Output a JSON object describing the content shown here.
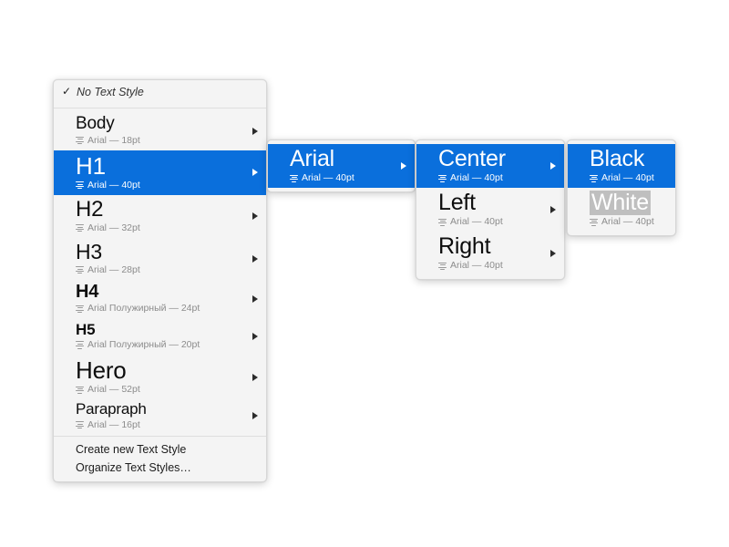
{
  "menus": {
    "text_styles": {
      "header": {
        "checkmark": "✓",
        "label": "No Text Style"
      },
      "items": [
        {
          "title": "Body",
          "sub": "Arial — 18pt",
          "selected": false,
          "size_class": "t-body"
        },
        {
          "title": "H1",
          "sub": "Arial — 40pt",
          "selected": true,
          "size_class": "t-h1"
        },
        {
          "title": "H2",
          "sub": "Arial — 32pt",
          "selected": false,
          "size_class": "t-h2"
        },
        {
          "title": "H3",
          "sub": "Arial — 28pt",
          "selected": false,
          "size_class": "t-h3"
        },
        {
          "title": "H4",
          "sub": "Arial Полужирный — 24pt",
          "selected": false,
          "size_class": "t-h4"
        },
        {
          "title": "H5",
          "sub": "Arial Полужирный — 20pt",
          "selected": false,
          "size_class": "t-h5"
        },
        {
          "title": "Hero",
          "sub": "Arial — 52pt",
          "selected": false,
          "size_class": "t-hero"
        },
        {
          "title": "Parapraph",
          "sub": "Arial — 16pt",
          "selected": false,
          "size_class": "t-para"
        }
      ],
      "footer_items": [
        {
          "label": "Create new Text Style"
        },
        {
          "label": "Organize Text Styles…"
        }
      ]
    },
    "font": {
      "items": [
        {
          "title": "Arial",
          "sub": "Arial — 40pt",
          "selected": true
        }
      ]
    },
    "alignment": {
      "items": [
        {
          "title": "Center",
          "sub": "Arial — 40pt",
          "selected": true
        },
        {
          "title": "Left",
          "sub": "Arial — 40pt",
          "selected": false
        },
        {
          "title": "Right",
          "sub": "Arial — 40pt",
          "selected": false
        }
      ]
    },
    "color": {
      "items": [
        {
          "title": "Black",
          "sub": "Arial — 40pt",
          "selected": true,
          "swatch": false
        },
        {
          "title": "White",
          "sub": "Arial — 40pt",
          "selected": false,
          "swatch": true
        }
      ]
    }
  },
  "icons": {
    "align_icon": "align-icon",
    "submenu_arrow": "chevron-right-icon",
    "checkmark": "check-icon"
  },
  "colors": {
    "selection_blue": "#0a6fdc",
    "panel_background": "#f4f4f4",
    "panel_border": "#d7d7d7",
    "title_text": "#0d0d0d",
    "sub_text": "#8c8c8c",
    "white_swatch": "#bfbfbf"
  }
}
